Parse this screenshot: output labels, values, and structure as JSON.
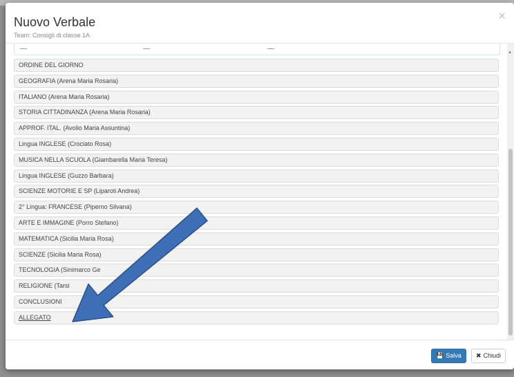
{
  "modal": {
    "title": "Nuovo Verbale",
    "subtitle": "Team: Consigli di classe 1A",
    "close_glyph": "×"
  },
  "sections": [
    "ORDINE DEL GIORNO",
    "GEOGRAFIA (Arena Maria Rosaria)",
    "ITALIANO (Arena Maria Rosaria)",
    "STORIA CITTADINANZA (Arena Maria Rosaria)",
    "APPROF. ITAL. (Avolio Maria Assuntina)",
    "Lingua INGLESE (Crociato Rosa)",
    "MUSICA NELLA SCUOLA (Giambarella Maria Teresa)",
    "Lingua INGLESE (Guzzo Barbara)",
    "SCIENZE MOTORIE E SP (Liparoti Andrea)",
    "2° Lingua: FRANCESE (Piperno Silvana)",
    "ARTE E IMMAGINE (Porro Stefano)",
    "MATEMATICA (Sicilia Maria Rosa)",
    "SCIENZE (Sicilia Maria Rosa)",
    "TECNOLOGIA (Sinimarco Ge",
    "RELIGIONE (Tarsi",
    "CONCLUSIONI",
    "ALLEGATO"
  ],
  "footer": {
    "save_label": "Salva",
    "save_icon": "floppy-disk-icon",
    "close_label": "Chiudi",
    "close_icon": "x-icon"
  },
  "annotation": {
    "arrow_color": "#3e6fb6",
    "arrow_outline": "#2b4f86"
  },
  "colors": {
    "primary": "#337ab7",
    "item_bg": "#f2f2f2"
  }
}
